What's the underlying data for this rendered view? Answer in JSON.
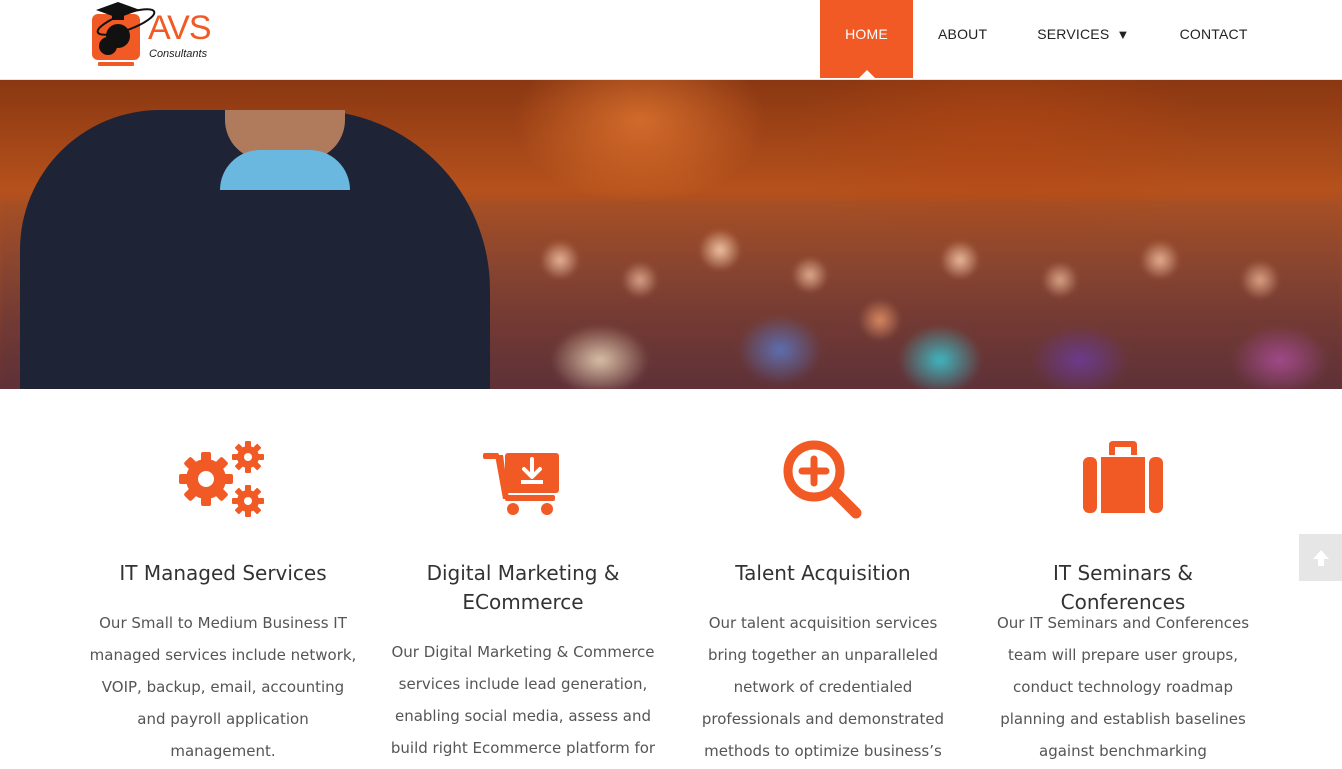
{
  "header": {
    "logo": {
      "brand": "AVS",
      "tagline": "Consultants"
    },
    "nav": [
      {
        "label": "HOME",
        "active": true
      },
      {
        "label": "ABOUT",
        "active": false
      },
      {
        "label": "SERVICES",
        "active": false,
        "dropdown": true,
        "caret": "▼"
      },
      {
        "label": "CONTACT",
        "active": false
      }
    ]
  },
  "hero": {
    "image": "speaker-presenting-to-audience-photo"
  },
  "services": [
    {
      "icon": "gears-icon",
      "title": "IT Managed Services",
      "description": "Our Small to Medium Business IT managed services include network, VOIP, backup, email, accounting and payroll application management."
    },
    {
      "icon": "shopping-cart-icon",
      "title": "Digital Marketing & ECommerce",
      "description": "Our Digital Marketing & Commerce services include lead generation, enabling social media, assess and build right Ecommerce platform for"
    },
    {
      "icon": "search-plus-icon",
      "title": "Talent Acquisition",
      "description": "Our talent acquisition services bring together an unparalleled network of credentialed professionals and demonstrated methods to optimize business’s most valuable asset:"
    },
    {
      "icon": "briefcase-icon",
      "title": "IT Seminars & Conferences",
      "description": "Our IT Seminars and Conferences team will prepare user groups, conduct technology roadmap planning and establish baselines against benchmarking"
    }
  ],
  "back_to_top": {
    "icon": "arrow-up-icon"
  },
  "colors": {
    "accent": "#f15a24",
    "text": "#555555",
    "heading": "#333333"
  }
}
